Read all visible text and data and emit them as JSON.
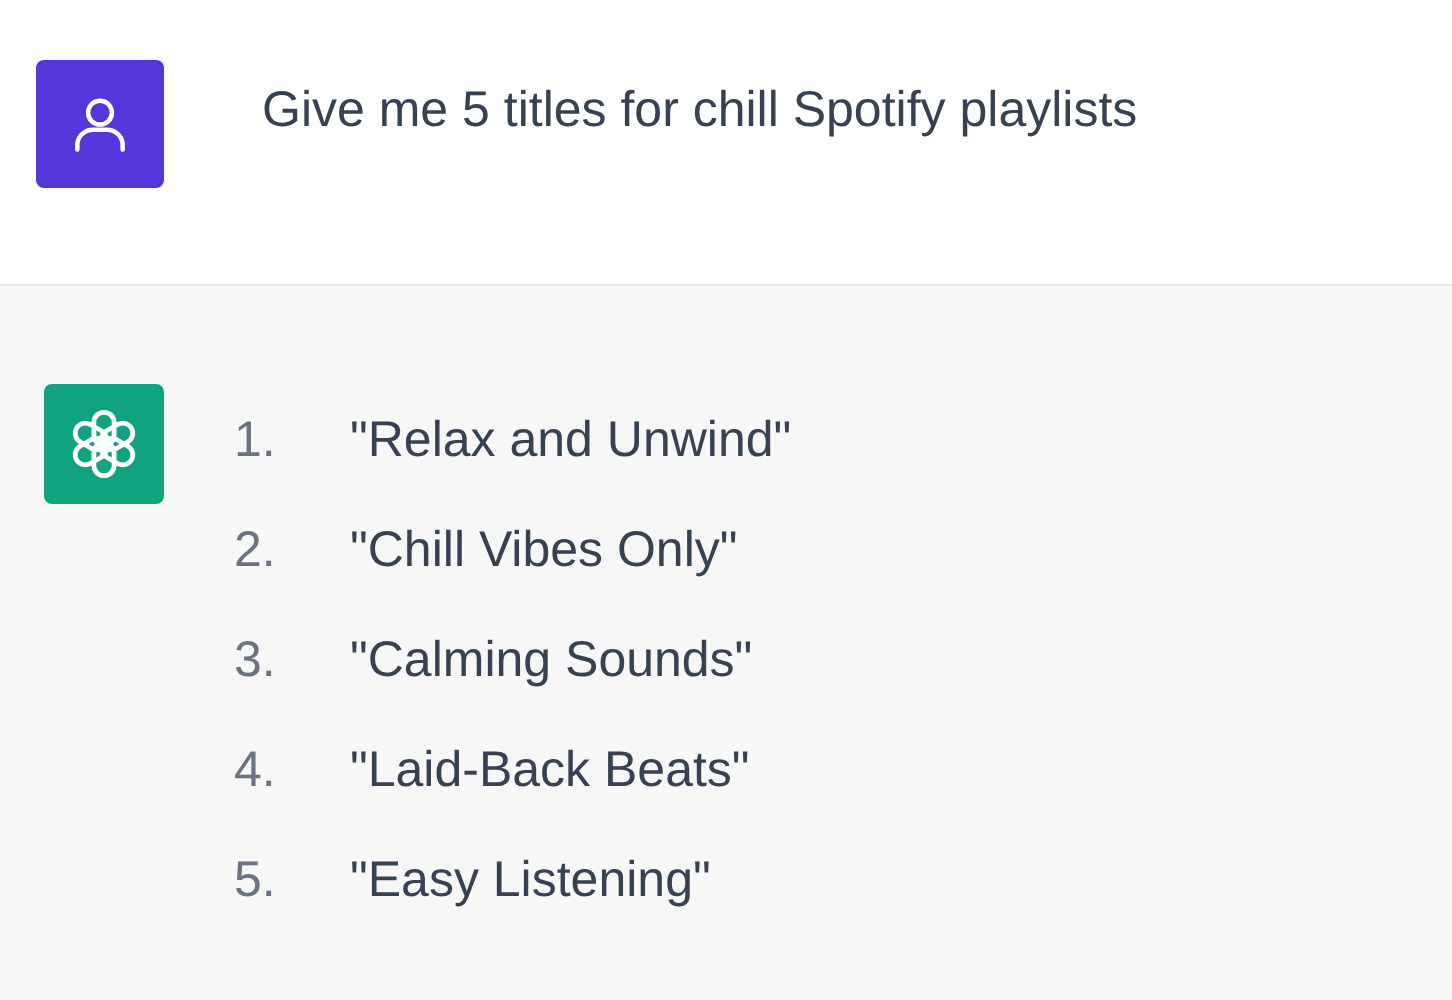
{
  "user_message": {
    "text": "Give me 5 titles for chill Spotify playlists"
  },
  "assistant_message": {
    "items": [
      {
        "number": "1.",
        "text": "\"Relax and Unwind\""
      },
      {
        "number": "2.",
        "text": "\"Chill Vibes Only\""
      },
      {
        "number": "3.",
        "text": "\"Calming Sounds\""
      },
      {
        "number": "4.",
        "text": "\"Laid-Back Beats\""
      },
      {
        "number": "5.",
        "text": "\"Easy Listening\""
      }
    ]
  }
}
